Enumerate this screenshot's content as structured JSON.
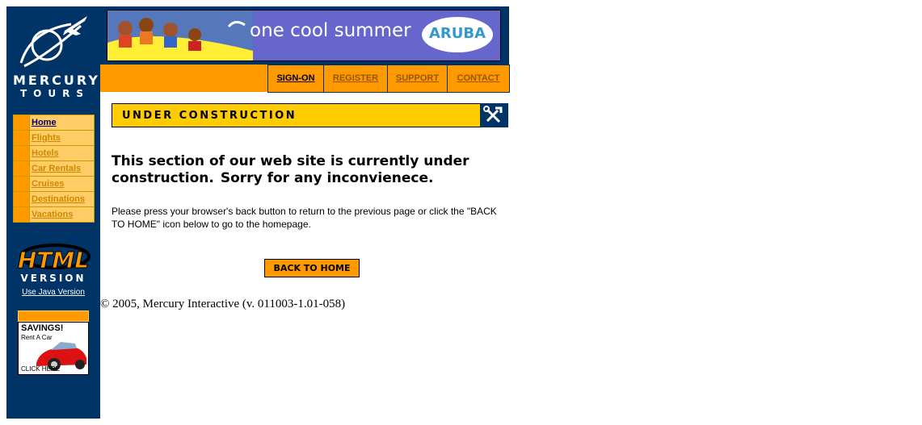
{
  "logo": {
    "line1": "MERCURY",
    "line2": "TOURS"
  },
  "nav": {
    "items": [
      {
        "label": "Home",
        "active": true
      },
      {
        "label": "Flights"
      },
      {
        "label": "Hotels"
      },
      {
        "label": "Car Rentals"
      },
      {
        "label": "Cruises"
      },
      {
        "label": "Destinations"
      },
      {
        "label": "Vacations"
      }
    ]
  },
  "html_version": {
    "line1": "HTML",
    "line2": "VERSION",
    "java_link": "Use Java Version"
  },
  "ad": {
    "title": "SAVINGS!",
    "subtitle": "Rent A Car",
    "cta": "CLICK HERE"
  },
  "banner": {
    "text": "one cool summer",
    "brand": "ARUBA"
  },
  "top_links": [
    "SIGN-ON",
    "REGISTER",
    "SUPPORT",
    "CONTACT"
  ],
  "section": {
    "title": "UNDER CONSTRUCTION",
    "heading_line1": "This section of our web site is currently under",
    "heading_line2a": "construction.",
    "heading_line2b": "Sorry for any inconvienece.",
    "paragraph": "Please press your browser's back button to return to the previous page or click the \"BACK TO HOME\" icon below to go to the homepage.",
    "button": "BACK TO HOME"
  },
  "footer": {
    "copyright": "© 2005, Mercury Interactive (v. 011003-1.01-058)"
  },
  "colors": {
    "navy": "#003366",
    "orange": "#ff9900",
    "yellow": "#ffcc00",
    "banner": "#6666cc"
  }
}
